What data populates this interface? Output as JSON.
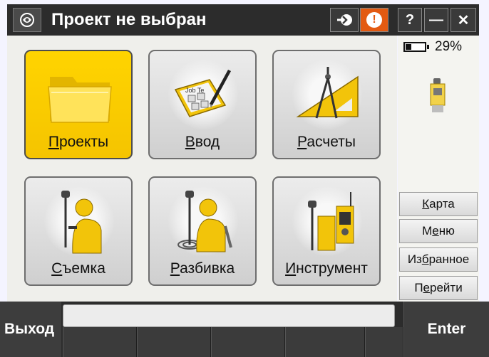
{
  "titlebar": {
    "title": "Проект не выбран",
    "help_label": "?",
    "minimize_label": "—",
    "close_label": "✕",
    "warning_glyph": "!"
  },
  "tiles": [
    {
      "label_accel": "П",
      "label_rest": "роекты",
      "icon": "folder-icon",
      "selected": true
    },
    {
      "label_accel": "В",
      "label_rest": "вод",
      "icon": "keyboard-pen-icon",
      "selected": false
    },
    {
      "label_accel": "Р",
      "label_rest": "асчеты",
      "icon": "compass-ruler-icon",
      "selected": false
    },
    {
      "label_pre": "",
      "label_accel": "С",
      "label_rest": "ъемка",
      "icon": "surveyor-icon",
      "selected": false
    },
    {
      "label_accel": "Р",
      "label_rest": "азбивка",
      "icon": "stakeout-icon",
      "selected": false
    },
    {
      "label_accel": "И",
      "label_rest": "нструмент",
      "icon": "instrument-icon",
      "selected": false
    }
  ],
  "status": {
    "battery_percent": "29%",
    "battery_level": 0.29
  },
  "side_buttons": [
    {
      "pre": "",
      "accel": "К",
      "rest": "арта"
    },
    {
      "pre": "М",
      "accel": "е",
      "rest": "ню"
    },
    {
      "pre": "Из",
      "accel": "б",
      "rest": "ранное"
    },
    {
      "pre": "П",
      "accel": "е",
      "rest": "рейти"
    }
  ],
  "bottombar": {
    "exit_label": "Выход",
    "enter_label": "Enter",
    "command_value": ""
  },
  "colors": {
    "accent_yellow": "#ffd400",
    "titlebar_bg": "#2c2c2c",
    "warning_orange": "#e35a12"
  }
}
